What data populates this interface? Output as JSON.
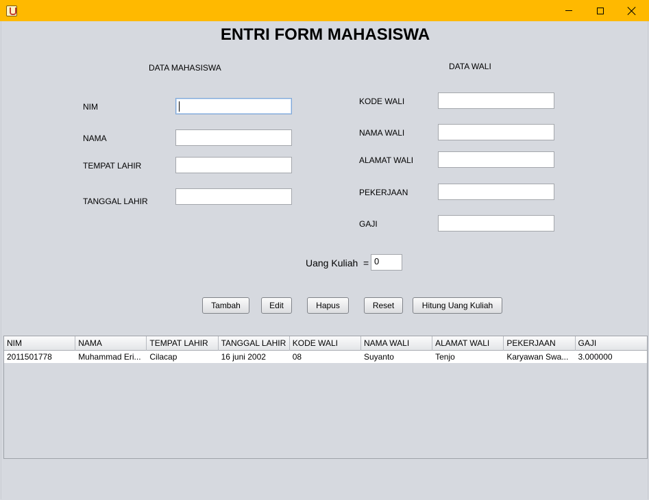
{
  "window": {
    "close_symbol": "close-icon",
    "maximize_symbol": "maximize-icon",
    "minimize_symbol": "minimize-icon"
  },
  "form": {
    "title": "ENTRI FORM MAHASISWA",
    "section_mahasiswa": "DATA MAHASISWA",
    "section_wali": "DATA WALI",
    "nim_label": "NIM",
    "nama_label": "NAMA",
    "tempat_lahir_label": "TEMPAT LAHIR",
    "tanggal_lahir_label": "TANGGAL LAHIR",
    "kode_wali_label": "KODE WALI",
    "nama_wali_label": "NAMA WALI",
    "alamat_wali_label": "ALAMAT WALI",
    "pekerjaan_label": "PEKERJAAN",
    "gaji_label": "GAJI",
    "uang_kuliah_label": "Uang Kuliah  =",
    "uang_kuliah_value": "0",
    "nim_value": "",
    "nama_value": "",
    "tempat_lahir_value": "",
    "tanggal_lahir_value": "",
    "kode_wali_value": "",
    "nama_wali_value": "",
    "alamat_wali_value": "",
    "pekerjaan_value": "",
    "gaji_value": ""
  },
  "buttons": {
    "tambah": "Tambah",
    "edit": "Edit",
    "hapus": "Hapus",
    "reset": "Reset",
    "hitung": "Hitung Uang Kuliah"
  },
  "table": {
    "columns": [
      "NIM",
      "NAMA",
      "TEMPAT LAHIR",
      "TANGGAL LAHIR",
      "KODE WALI",
      "NAMA WALI",
      "ALAMAT WALI",
      "PEKERJAAN",
      "GAJI"
    ],
    "rows": [
      [
        "2011501778",
        "Muhammad Eri...",
        "Cilacap",
        "16 juni 2002",
        "08",
        "Suyanto",
        "Tenjo",
        "Karyawan Swa...",
        "3.000000"
      ]
    ]
  }
}
